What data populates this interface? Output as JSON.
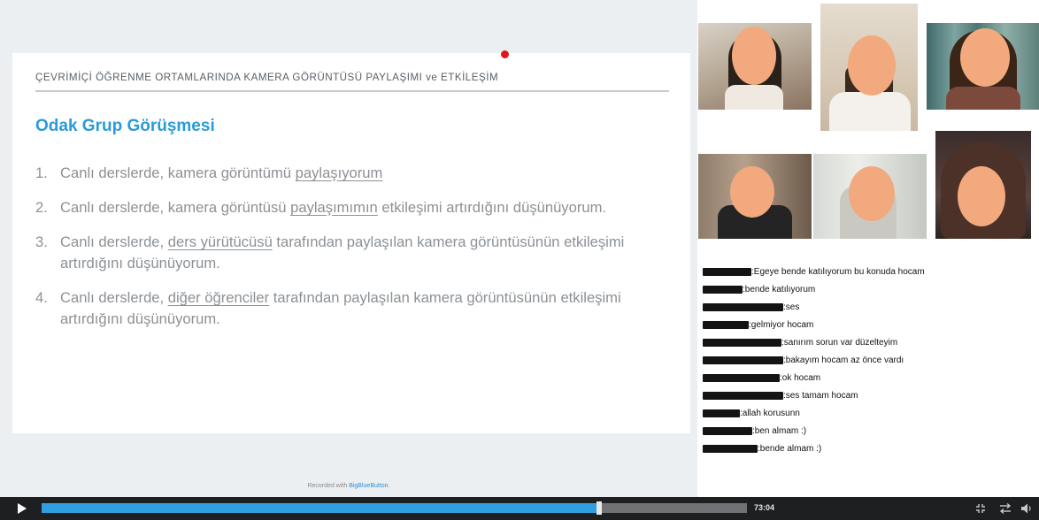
{
  "slide": {
    "header": "ÇEVRİMİÇİ ÖĞRENME ORTAMLARINDA KAMERA GÖRÜNTÜSÜ PAYLAŞIMI ve ETKİLEŞİM",
    "heading": "Odak Grup Görüşmesi",
    "items": [
      {
        "num": "1.",
        "pre": "Canlı derslerde, kamera görüntümü ",
        "ul": "paylaşıyorum",
        "post": ""
      },
      {
        "num": "2.",
        "pre": "Canlı derslerde, kamera görüntüsü ",
        "ul": "paylaşımımın",
        "post": " etkileşimi artırdığını düşünüyorum."
      },
      {
        "num": "3.",
        "pre": "Canlı derslerde, ",
        "ul": "ders yürütücüsü",
        "post": " tarafından paylaşılan kamera görüntüsünün etkileşimi artırdığını düşünüyorum."
      },
      {
        "num": "4.",
        "pre": "Canlı derslerde, ",
        "ul": "diğer öğrenciler",
        "post": " tarafından paylaşılan kamera görüntüsünün etkileşimi artırdığını düşünüyorum."
      }
    ]
  },
  "footer": {
    "recorded_prefix": "Recorded with ",
    "recorded_brand": "BigBlueButton."
  },
  "chat": {
    "messages": [
      {
        "text": ":Egeye bende katılıyorum bu konuda hocam"
      },
      {
        "text": ":bende katılıyorum"
      },
      {
        "text": ":ses"
      },
      {
        "text": ":gelmiyor hocam"
      },
      {
        "text": ":sanırım sorun var düzelteyim"
      },
      {
        "text": ":bakayım hocam az önce vardı"
      },
      {
        "text": ":ok hocam"
      },
      {
        "text": ":ses tamam hocam"
      },
      {
        "text": ":allah korusunn"
      },
      {
        "text": ":ben almam :)"
      },
      {
        "text": ":bende almam :)"
      }
    ]
  },
  "player": {
    "time": "73:04",
    "progress": 0.79,
    "play_icon": "play-icon",
    "fullscreen_icon": "fullscreen-icon",
    "swap_icon": "swap-layout-icon",
    "volume_icon": "volume-icon"
  },
  "colors": {
    "heading": "#2a9bd8",
    "progress_fill": "#2f9fe1",
    "pointer": "#e0161d",
    "face_mask": "#f2a97e"
  }
}
